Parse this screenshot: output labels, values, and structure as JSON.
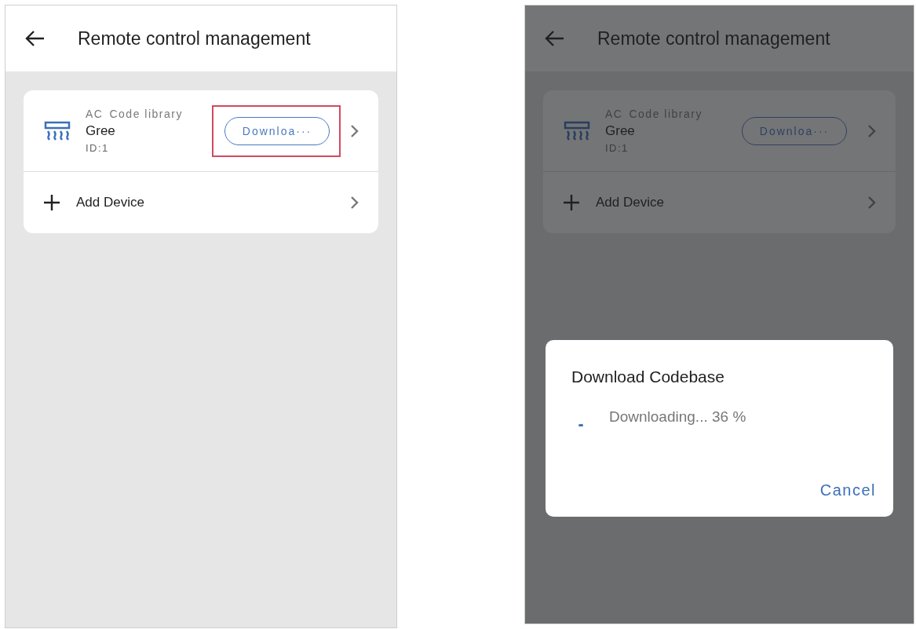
{
  "screens": [
    {
      "header": {
        "title": "Remote control management"
      },
      "device": {
        "category": "AC",
        "library": "Code library",
        "name": "Gree",
        "id": "ID:1",
        "button": "Downloa···",
        "highlighted": true
      },
      "add_row": {
        "label": "Add Device"
      },
      "dimmed": false
    },
    {
      "header": {
        "title": "Remote control management"
      },
      "device": {
        "category": "AC",
        "library": "Code library",
        "name": "Gree",
        "id": "ID:1",
        "button": "Downloa···",
        "highlighted": false
      },
      "add_row": {
        "label": "Add Device"
      },
      "dimmed": true,
      "dialog": {
        "title": "Download Codebase",
        "message": "Downloading... 36 %",
        "cancel": "Cancel"
      }
    }
  ]
}
